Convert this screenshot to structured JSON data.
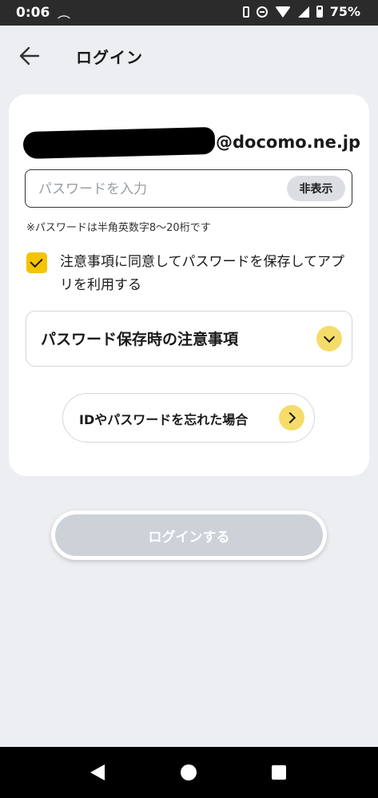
{
  "status_bar": {
    "time": "0:06",
    "battery": "75%"
  },
  "header": {
    "title": "ログイン"
  },
  "login_form": {
    "email_domain": "@docomo.ne.jp",
    "password_placeholder": "パスワードを入力",
    "toggle_label": "非表示",
    "password_note": "※パスワードは半角英数字8〜20桁です",
    "agree_checked": true,
    "agree_label": "注意事項に同意してパスワードを保存してアプリを利用する",
    "notice_title": "パスワード保存時の注意事項",
    "forgot_label": "IDやパスワードを忘れた場合",
    "submit_label": "ログインする"
  },
  "colors": {
    "accent_yellow": "#f5c400",
    "disabled_button": "#cdd1d8"
  }
}
